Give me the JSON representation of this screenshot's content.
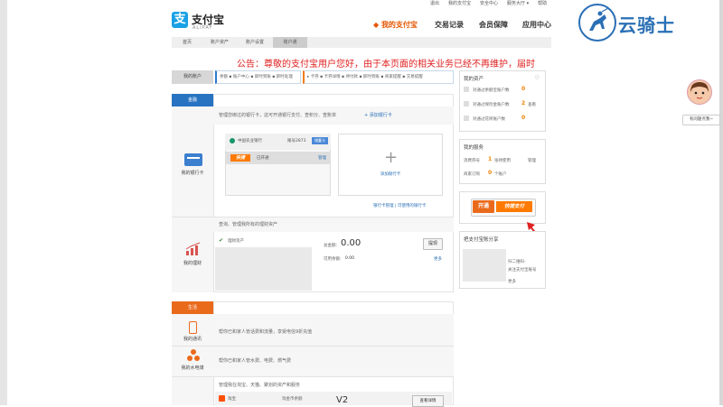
{
  "toplinks": [
    "退出",
    "我的支付宝",
    "安全中心",
    "服务大厅 ▾",
    "帮助"
  ],
  "logo": {
    "cn": "支付宝",
    "en": "ALIPAY",
    "glyph": "支"
  },
  "mainnav": {
    "items": [
      "◆ 我的支付宝",
      "交易记录",
      "会员保障",
      "应用中心"
    ]
  },
  "subnav": {
    "items": [
      "首页",
      "账户资产",
      "账户设置",
      "账户通"
    ]
  },
  "watermark": {
    "text": "云骑士"
  },
  "notice": "公告：尊敬的支付宝用户您好，由于本页面的相关业务已经不再维护，届时",
  "account": {
    "label": "我的账户",
    "line1": "余额  ▪ 账户中心  ▪ 即时到账  ▪ 即时处理",
    "line2": "▸ 卡券  ▪ 卡券详情  ▪ 待付款  ▪ 即时到账  ▪ 商家提醒  ▪ 交易提醒"
  },
  "finance": {
    "header": "金融",
    "bankcard": {
      "label": "我的银行卡",
      "desc": "管理您绑过的银行卡，这可开通银行支付、查积分、查账单",
      "add_link": "+ 添加银行卡",
      "card_bank": "中国农业银行",
      "card_tail": "尾号2873",
      "card_badge": "储蓄卡",
      "kuaijie": "快捷",
      "kuaijie_status": "已开通",
      "kuaijie_manage": "管理",
      "add_card": "添加银行卡",
      "bottom_links": "银行卡管理 | 可使用的银行卡"
    },
    "wealth": {
      "label": "我的理财",
      "desc": "查询、管理我所有的理财资产",
      "item": "理财资产",
      "total_label": "总金额:",
      "total": "0.00",
      "avail_label": "可用余额:",
      "avail": "0.00",
      "btn": "提现",
      "more": "更多"
    }
  },
  "life": {
    "header": "生活",
    "mobile": {
      "label": "我的通讯",
      "desc": "帮你已和家人管话费和流量，享受电信9折充值"
    },
    "utility": {
      "label": "我的水电煤",
      "desc": "帮你已和家人管水费、电费、燃气费"
    },
    "taobao": {
      "desc": "管理我在淘宝、天猫、聚划的资产和服务",
      "name": "淘宝",
      "sub": "淘金币余额",
      "value": "V2",
      "btn": "查看详情"
    }
  },
  "right": {
    "myaccounts": {
      "title": "我的资产",
      "rows": [
        {
          "label": "对通过余额宝账户数",
          "value": "0"
        },
        {
          "label": "对通过保险金账户数",
          "value": "2",
          "link": "查看"
        },
        {
          "label": "对通过花呗账户数",
          "value": "0"
        }
      ]
    },
    "service": {
      "title": "我的服务",
      "rows": [
        {
          "label": "消费券号",
          "value": "1",
          "unit": "张待使用",
          "link": "管理"
        },
        {
          "label": "商家订购",
          "value": "0",
          "unit": "个账户"
        }
      ]
    },
    "promo": {
      "btn": "开通",
      "kuaijie": "快捷支付"
    },
    "share": {
      "title": "把支付宝账分享",
      "line1": "扫二维码-",
      "line2": "关注支付宝账号",
      "more": "更多"
    }
  },
  "help": {
    "label": "有问题点我~"
  },
  "colors": {
    "orange": "#ea6a1c",
    "blue": "#2773c2",
    "red": "#e02020"
  }
}
